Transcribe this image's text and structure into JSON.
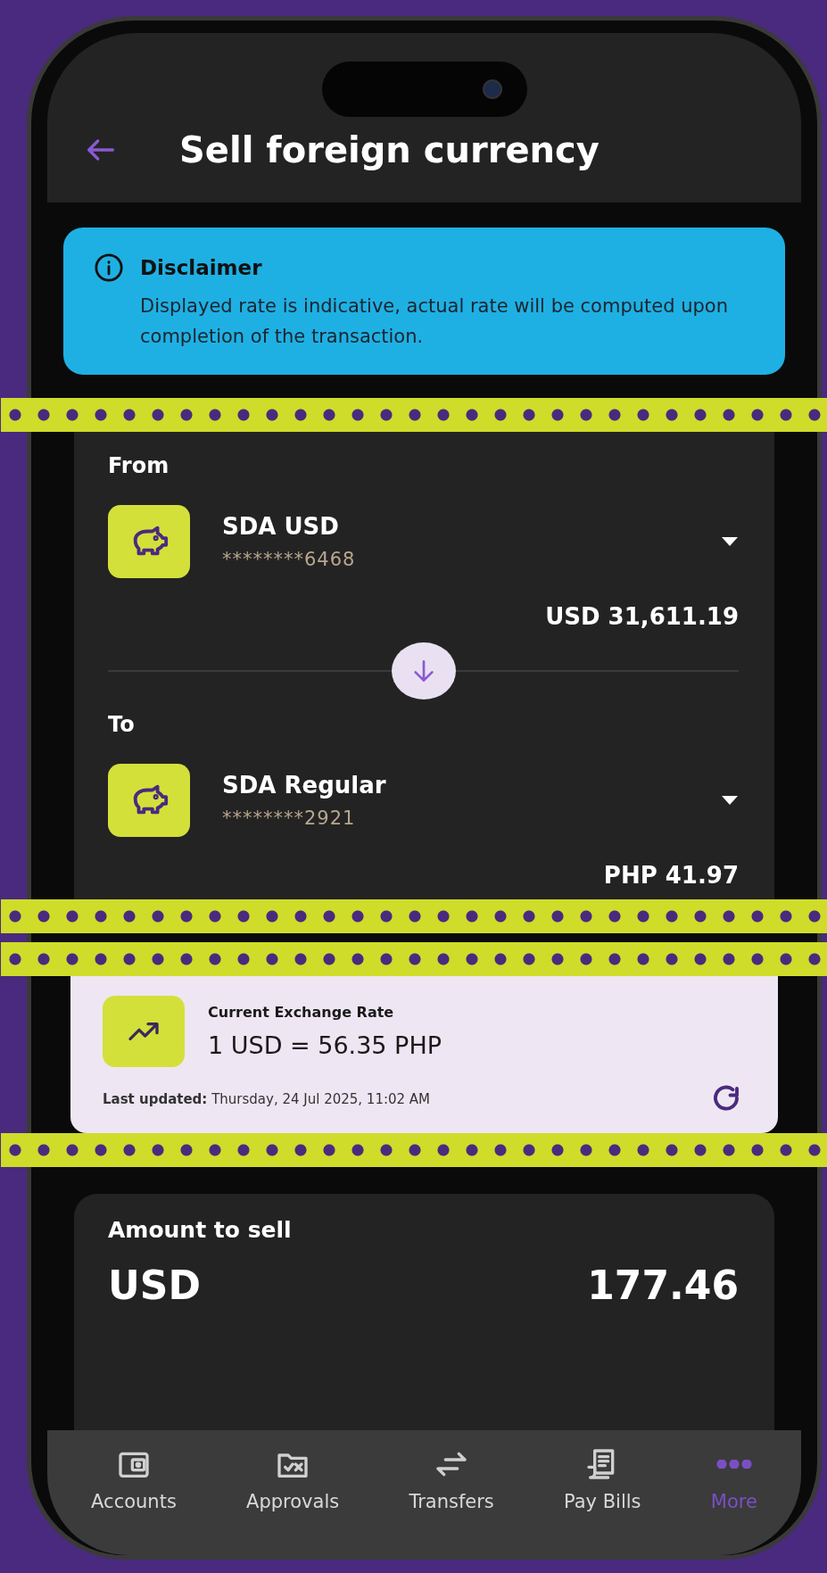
{
  "header": {
    "title": "Sell foreign currency"
  },
  "disclaimer": {
    "title": "Disclaimer",
    "text": "Displayed rate is indicative, actual rate will be computed upon completion of the transaction."
  },
  "accounts": [
    {
      "label": "From",
      "name": "SDA USD",
      "number": "********6468",
      "balance": "USD 31,611.19"
    },
    {
      "label": "To",
      "name": "SDA Regular",
      "number": "********2921",
      "balance": "PHP 41.97"
    }
  ],
  "exchange_rate": {
    "label": "Current Exchange Rate",
    "rate": "1 USD = 56.35 PHP",
    "last_updated": "**Last updated:** Thursday, 24 Jul 2025, 11:02 AM"
  },
  "amount": {
    "label": "Amount to sell",
    "currency": "USD",
    "value": "177.46"
  },
  "nav": [
    {
      "label": "Accounts",
      "selected": false
    },
    {
      "label": "Approvals",
      "selected": false
    },
    {
      "label": "Transfers",
      "selected": false
    },
    {
      "label": "Pay Bills",
      "selected": false
    },
    {
      "label": "More",
      "selected": true
    }
  ]
}
